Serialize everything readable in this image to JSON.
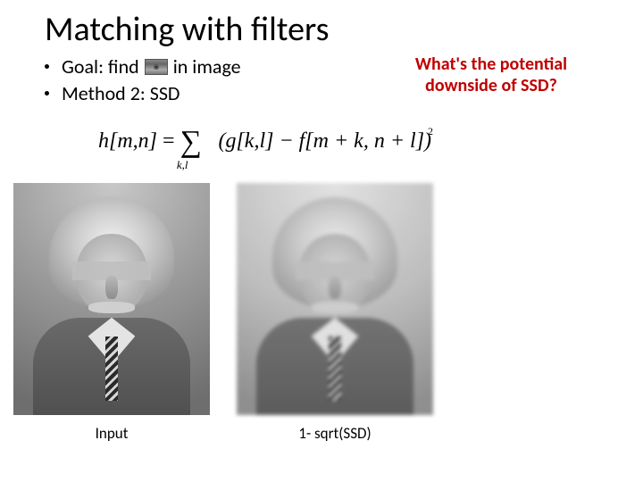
{
  "title": "Matching with filters",
  "bullets": {
    "goal_prefix": "Goal: find",
    "goal_suffix": "in image",
    "method": "Method 2: SSD"
  },
  "callout": {
    "line1": "What's the potential",
    "line2": "downside of SSD?"
  },
  "equation": {
    "lhs": "h[m,n]",
    "eq": "=",
    "sum_symbol": "∑",
    "sum_sub": "k,l",
    "body": "(g[k,l] − f[m + k, n + l])",
    "power": "2"
  },
  "captions": {
    "input": "Input",
    "result": "1- sqrt(SSD)"
  }
}
